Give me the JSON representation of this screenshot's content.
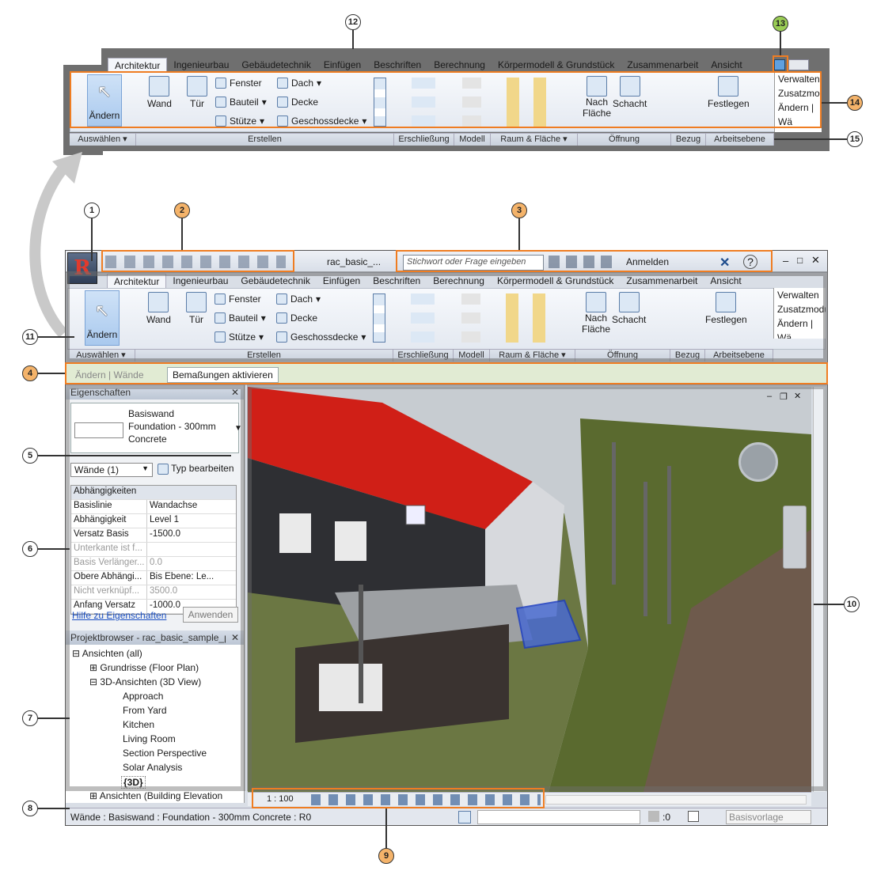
{
  "top_ribbon": {
    "tabs": [
      "Architektur",
      "Ingenieurbau",
      "Gebäudetechnik",
      "Einfügen",
      "Beschriften",
      "Berechnung",
      "Körpermodell & Grundstück",
      "Zusammenarbeit",
      "Ansicht"
    ],
    "modify": "Ändern",
    "wall": "Wand",
    "door": "Tür",
    "window": "Fenster",
    "component": "Bauteil",
    "column": "Stütze",
    "roof": "Dach",
    "ceiling": "Decke",
    "floor": "Geschossdecke",
    "by_face": "Nach",
    "by_face2": "Fläche",
    "shaft": "Schacht",
    "set": "Festlegen",
    "manage": "Verwalten",
    "addins": "Zusatzmodu",
    "modify_walls": "Ändern | Wä",
    "panels": [
      "Auswählen ▾",
      "Erstellen",
      "Erschließung",
      "Modell",
      "Raum & Fläche ▾",
      "Öffnung",
      "Bezug",
      "Arbeitsebene"
    ]
  },
  "app_ribbon": {
    "tabs": [
      "Architektur",
      "Ingenieurbau",
      "Gebäudetechnik",
      "Einfügen",
      "Beschriften",
      "Berechnung",
      "Körpermodell & Grundstück",
      "Zusammenarbeit",
      "Ansicht"
    ],
    "modify": "Ändern",
    "wall": "Wand",
    "door": "Tür",
    "window": "Fenster",
    "component": "Bauteil",
    "column": "Stütze",
    "roof": "Dach",
    "ceiling": "Decke",
    "floor": "Geschossdecke",
    "by_face": "Nach",
    "by_face2": "Fläche",
    "shaft": "Schacht",
    "set": "Festlegen",
    "manage": "Verwalten",
    "addins": "Zusatzmodu",
    "modify_walls": "Ändern | Wä",
    "panels": [
      "Auswählen ▾",
      "Erstellen",
      "Erschließung",
      "Modell",
      "Raum & Fläche ▾",
      "Öffnung",
      "Bezug",
      "Arbeitsebene"
    ]
  },
  "title_bar": {
    "file": "rac_basic_...",
    "search_placeholder": "Stichwort oder Frage eingeben",
    "signin": "Anmelden"
  },
  "context_bar": {
    "label": "Ändern | Wände",
    "button": "Bemaßungen aktivieren"
  },
  "properties": {
    "title": "Eigenschaften",
    "type_family": "Basiswand",
    "type_name": "Foundation - 300mm",
    "type_material": "Concrete",
    "filter": "Wände (1)",
    "edit_type": "Typ bearbeiten",
    "group": "Abhängigkeiten",
    "rows": [
      {
        "k": "Basislinie",
        "v": "Wandachse",
        "dis": false
      },
      {
        "k": "Abhängigkeit",
        "v": "Level 1",
        "dis": false
      },
      {
        "k": "Versatz Basis",
        "v": "-1500.0",
        "dis": false
      },
      {
        "k": "Unterkante ist f...",
        "v": "",
        "dis": true
      },
      {
        "k": "Basis Verlänger...",
        "v": "0.0",
        "dis": true
      },
      {
        "k": "Obere Abhängi...",
        "v": "Bis Ebene: Le...",
        "dis": false
      },
      {
        "k": "Nicht verknüpf...",
        "v": "3500.0",
        "dis": true
      },
      {
        "k": "Anfang Versatz",
        "v": "-1000.0",
        "dis": false
      }
    ],
    "help": "Hilfe zu Eigenschaften",
    "apply": "Anwenden"
  },
  "browser": {
    "title": "Projektbrowser - rac_basic_sample_p...",
    "items": [
      "Ansichten (all)",
      "Grundrisse (Floor Plan)",
      "3D-Ansichten (3D View)",
      "Approach",
      "From Yard",
      "Kitchen",
      "Living Room",
      "Section Perspective",
      "Solar Analysis",
      "{3D}",
      "Ansichten (Building Elevation"
    ]
  },
  "view_bar": {
    "scale": "1 : 100"
  },
  "status_bar": {
    "text": "Wände : Basiswand : Foundation - 300mm Concrete : R0",
    "counter": ":0",
    "template": "Basisvorlage"
  },
  "callouts": [
    "1",
    "2",
    "3",
    "4",
    "5",
    "6",
    "7",
    "8",
    "9",
    "10",
    "11",
    "12",
    "13",
    "14",
    "15"
  ]
}
